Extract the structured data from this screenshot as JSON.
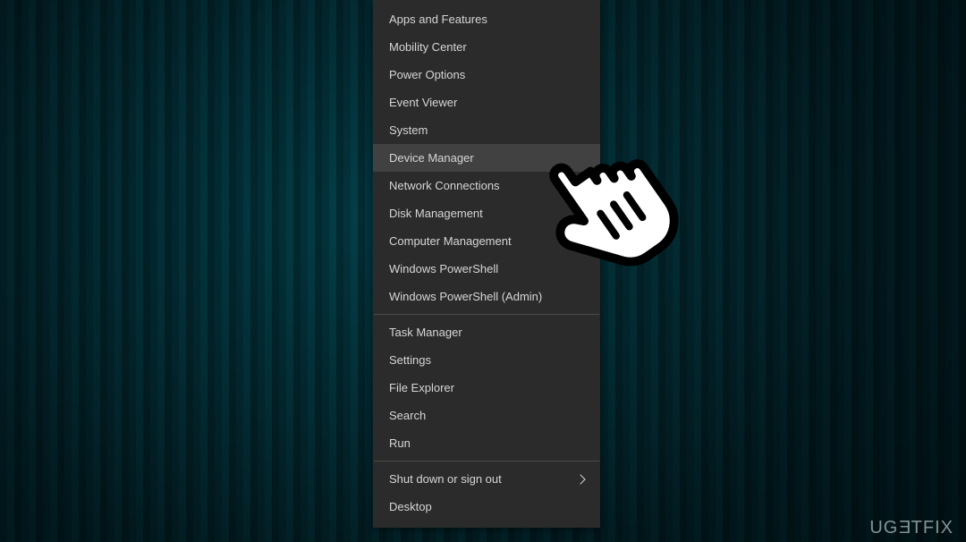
{
  "menu": {
    "groups": [
      {
        "items": [
          {
            "label": "Apps and Features",
            "highlight": false,
            "submenu": false
          },
          {
            "label": "Mobility Center",
            "highlight": false,
            "submenu": false
          },
          {
            "label": "Power Options",
            "highlight": false,
            "submenu": false
          },
          {
            "label": "Event Viewer",
            "highlight": false,
            "submenu": false
          },
          {
            "label": "System",
            "highlight": false,
            "submenu": false
          },
          {
            "label": "Device Manager",
            "highlight": true,
            "submenu": false
          },
          {
            "label": "Network Connections",
            "highlight": false,
            "submenu": false
          },
          {
            "label": "Disk Management",
            "highlight": false,
            "submenu": false
          },
          {
            "label": "Computer Management",
            "highlight": false,
            "submenu": false
          },
          {
            "label": "Windows PowerShell",
            "highlight": false,
            "submenu": false
          },
          {
            "label": "Windows PowerShell (Admin)",
            "highlight": false,
            "submenu": false
          }
        ]
      },
      {
        "items": [
          {
            "label": "Task Manager",
            "highlight": false,
            "submenu": false
          },
          {
            "label": "Settings",
            "highlight": false,
            "submenu": false
          },
          {
            "label": "File Explorer",
            "highlight": false,
            "submenu": false
          },
          {
            "label": "Search",
            "highlight": false,
            "submenu": false
          },
          {
            "label": "Run",
            "highlight": false,
            "submenu": false
          }
        ]
      },
      {
        "items": [
          {
            "label": "Shut down or sign out",
            "highlight": false,
            "submenu": true
          },
          {
            "label": "Desktop",
            "highlight": false,
            "submenu": false
          }
        ]
      }
    ]
  },
  "watermark": {
    "text_pre": "UG",
    "text_e": "E",
    "text_post": "TFIX"
  },
  "colors": {
    "menu_bg": "#2b2b2b",
    "menu_highlight": "#414141",
    "menu_text": "#d6d6d6",
    "separator": "#4a4a4a"
  }
}
